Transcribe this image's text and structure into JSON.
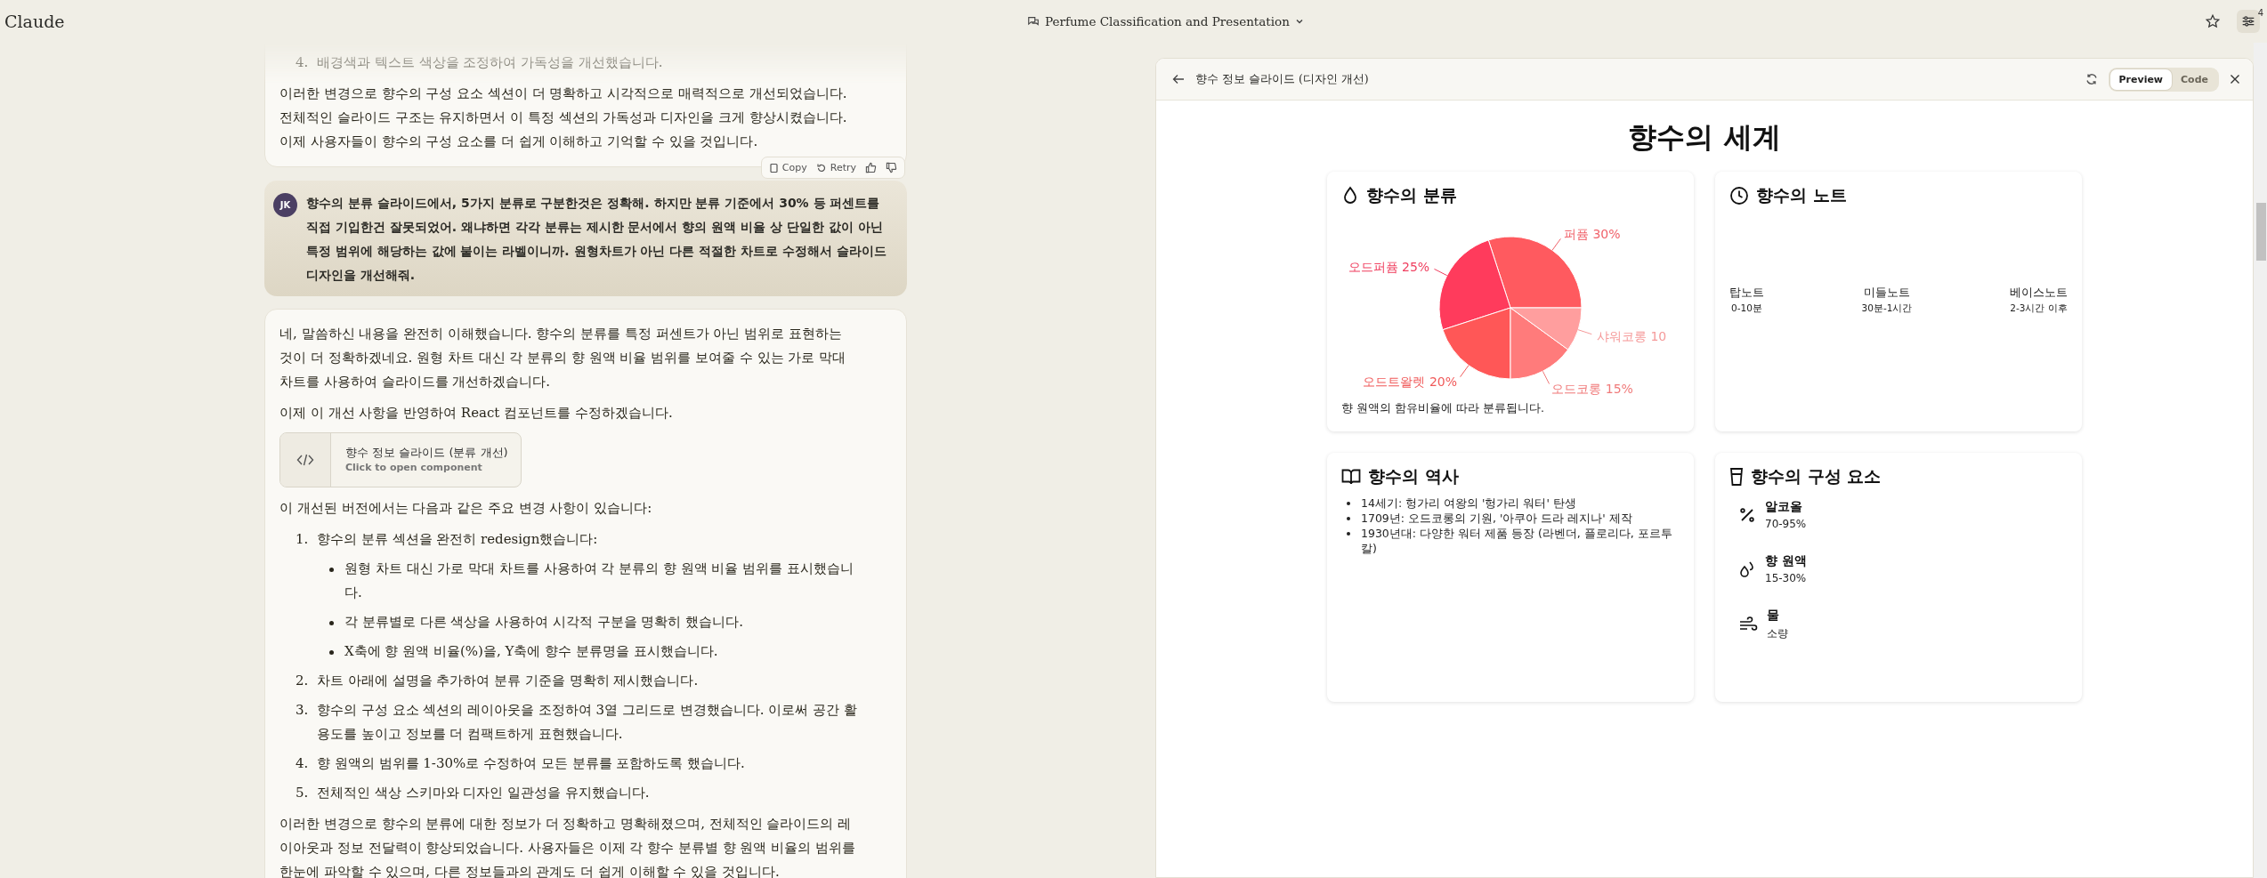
{
  "app": {
    "name": "Claude"
  },
  "conversation": {
    "title": "Perfume Classification and Presentation",
    "badge": "4"
  },
  "chat": [
    {
      "kind": "assistant",
      "blocks": [
        {
          "kind": "list",
          "items": [
            {
              "number": "4.",
              "text": "배경색과 텍스트 색상을 조정하여 가독성을 개선했습니다."
            }
          ]
        },
        {
          "kind": "paragraph",
          "text": "이러한 변경으로 향수의 구성 요소 섹션이 더 명확하고 시각적으로 매력적으로 개선되었습니다. 전체적인 슬라이드 구조는 유지하면서 이 특정 섹션의 가독성과 디자인을 크게 향상시켰습니다. 이제 사용자들이 향수의 구성 요소를 더 쉽게 이해하고 기억할 수 있을 것입니다."
        }
      ],
      "actions": [
        "Copy",
        "Retry"
      ]
    },
    {
      "kind": "user",
      "initials": "JK",
      "text": "향수의 분류 슬라이드에서, **5**가지 분류로 구분한것은 정확해. 하지만 분류 기준에서 **30%** 등 퍼센트를 직접 기입한건 잘못되었어. 왜냐하면 각각 분류는 제시한 문서에서 향의 원액 비율 상 단일한 값이 아닌 특정 범위에 해당하는 값에 붙이는 라벨이니까. 원형차트가 아닌 다른 적절한 차트로 수정해서 슬라이드 디자인을 개선해줘."
    },
    {
      "kind": "assistant",
      "blocks": [
        {
          "kind": "paragraph",
          "text": "네, 말씀하신 내용을 완전히 이해했습니다. 향수의 분류를 특정 퍼센트가 아닌 범위로 표현하는 것이 더 정확하겠네요. 원형 차트 대신 각 분류의 향 원액 비율 범위를 보여줄 수 있는 가로 막대 차트를 사용하여 슬라이드를 개선하겠습니다."
        },
        {
          "kind": "paragraph",
          "text": "이제 이 개선 사항을 반영하여 React 컴포넌트를 수정하겠습니다."
        },
        {
          "kind": "artifact",
          "title": "향수 정보 슬라이드 (분류 개선)",
          "subtitle": "Click to open component"
        },
        {
          "kind": "paragraph",
          "text": "이 개선된 버전에서는 다음과 같은 주요 변경 사항이 있습니다:"
        },
        {
          "kind": "list",
          "items": [
            {
              "number": "1.",
              "text": "향수의 분류 섹션을 완전히 redesign했습니다:",
              "children": [
                "원형 차트 대신 가로 막대 차트를 사용하여 각 분류의 향 원액 비율 범위를 표시했습니다.",
                "각 분류별로 다른 색상을 사용하여 시각적 구분을 명확히 했습니다.",
                "X축에 향 원액 비율(%)을, Y축에 향수 분류명을 표시했습니다."
              ]
            },
            {
              "number": "2.",
              "text": "차트 아래에 설명을 추가하여 분류 기준을 명확히 제시했습니다."
            },
            {
              "number": "3.",
              "text": "향수의 구성 요소 섹션의 레이아웃을 조정하여 3열 그리드로 변경했습니다. 이로써 공간 활용도를 높이고 정보를 더 컴팩트하게 표현했습니다."
            },
            {
              "number": "4.",
              "text": "향 원액의 범위를 1-30%로 수정하여 모든 분류를 포함하도록 했습니다."
            },
            {
              "number": "5.",
              "text": "전체적인 색상 스키마와 디자인 일관성을 유지했습니다."
            }
          ]
        },
        {
          "kind": "paragraph",
          "text": "이러한 변경으로 향수의 분류에 대한 정보가 더 정확하고 명확해졌으며, 전체적인 슬라이드의 레이아웃과 정보 전달력이 향상되었습니다. 사용자들은 이제 각 향수 분류별 향 원액 비율의 범위를 한눈에 파악할 수 있으며, 다른 정보들과의 관계도 더 쉽게 이해할 수 있을 것입니다."
        }
      ]
    }
  ],
  "artifact_panel": {
    "title": "향수 정보 슬라이드 (디자인 개선)",
    "tabs": [
      {
        "label": "Preview",
        "selected": true
      },
      {
        "label": "Code",
        "selected": false
      }
    ],
    "slide": {
      "title": "향수의 세계",
      "cards": [
        {
          "kind": "pie",
          "title": "향수의 분류",
          "chart_data": {
            "type": "pie",
            "categories": [
              "퍼퓸",
              "오드퍼퓸",
              "오드트왈렛",
              "오드코롱",
              "샤워코롱"
            ],
            "values": [
              30,
              25,
              20,
              15,
              10
            ],
            "value_labels": [
              "30%",
              "25%",
              "20%",
              "15%",
              "10"
            ]
          },
          "caption": "향 원액의 함유비율에 따라 분류됩니다."
        },
        {
          "kind": "notes",
          "title": "향수의 노트",
          "notes": [
            {
              "name": "탑노트",
              "time": "0-10분"
            },
            {
              "name": "미들노트",
              "time": "30분-1시간"
            },
            {
              "name": "베이스노트",
              "time": "2-3시간 이후"
            }
          ]
        },
        {
          "kind": "list",
          "title": "향수의 역사",
          "items": [
            "14세기: 헝가리 여왕의 '헝가리 워터' 탄생",
            "1709년: 오드코롱의 기원, '아쿠아 드라 레지나' 제작",
            "1930년대: 다양한 워터 제품 등장 (라벤더, 플로리다, 포르투칼)"
          ]
        },
        {
          "kind": "components",
          "title": "향수의 구성 요소",
          "items": [
            {
              "name": "알코올",
              "value": "70-95%"
            },
            {
              "name": "향 원액",
              "value": "15-30%"
            },
            {
              "name": "물",
              "value": "소량"
            }
          ]
        }
      ]
    }
  }
}
